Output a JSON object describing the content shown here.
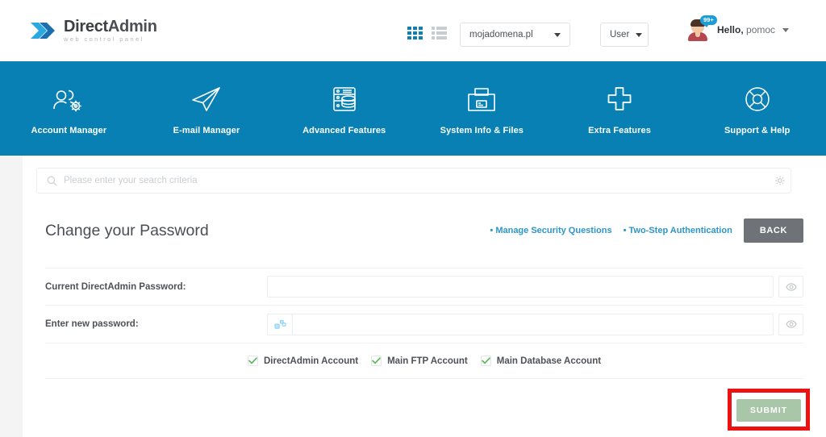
{
  "brand": {
    "name_bold": "Direct",
    "name_light": "Admin",
    "tagline": "web control panel",
    "logo_icon": "directadmin-chevrons-logo",
    "accent_blue": "#0880b4",
    "link_blue": "#2b96c9"
  },
  "header": {
    "view_grid_icon": "grid-view-icon",
    "view_list_icon": "list-view-icon",
    "domain_select": {
      "value": "mojadomena.pl",
      "icon": "chevron-down-icon"
    },
    "user_select": {
      "value": "User",
      "icon": "chevron-down-icon"
    },
    "avatar_icon": "user-avatar",
    "notification_count": "99+",
    "greeting_prefix": "Hello,",
    "username": "pomoc",
    "user_menu_icon": "chevron-down-icon"
  },
  "nav": {
    "items": [
      {
        "label": "Account Manager",
        "icon": "users-gear-icon"
      },
      {
        "label": "E-mail Manager",
        "icon": "paper-plane-icon"
      },
      {
        "label": "Advanced Features",
        "icon": "server-database-icon"
      },
      {
        "label": "System Info & Files",
        "icon": "folder-files-icon"
      },
      {
        "label": "Extra Features",
        "icon": "plus-icon"
      },
      {
        "label": "Support & Help",
        "icon": "life-ring-icon"
      }
    ]
  },
  "search": {
    "placeholder": "Please enter your search criteria",
    "icon": "search-icon",
    "settings_icon": "gear-icon"
  },
  "main": {
    "title": "Change your Password",
    "links": [
      {
        "label": "• Manage Security Questions"
      },
      {
        "label": "• Two-Step Authentication"
      }
    ],
    "back_label": "BACK",
    "fields": [
      {
        "label": "Current DirectAdmin Password:",
        "value": "",
        "placeholder": "",
        "has_generator": false,
        "reveal_icon": "eye-icon"
      },
      {
        "label": "Enter new password:",
        "value": "",
        "placeholder": "",
        "has_generator": true,
        "generator_icon": "random-password-icon",
        "reveal_icon": "eye-icon"
      }
    ],
    "checkboxes": [
      {
        "label": "DirectAdmin Account",
        "checked": true,
        "icon": "checkmark-icon"
      },
      {
        "label": "Main FTP Account",
        "checked": true,
        "icon": "checkmark-icon"
      },
      {
        "label": "Main Database Account",
        "checked": true,
        "icon": "checkmark-icon"
      }
    ],
    "submit_label": "SUBMIT",
    "submit_color": "#a8c6a8",
    "highlight_color": "#ee1111"
  }
}
